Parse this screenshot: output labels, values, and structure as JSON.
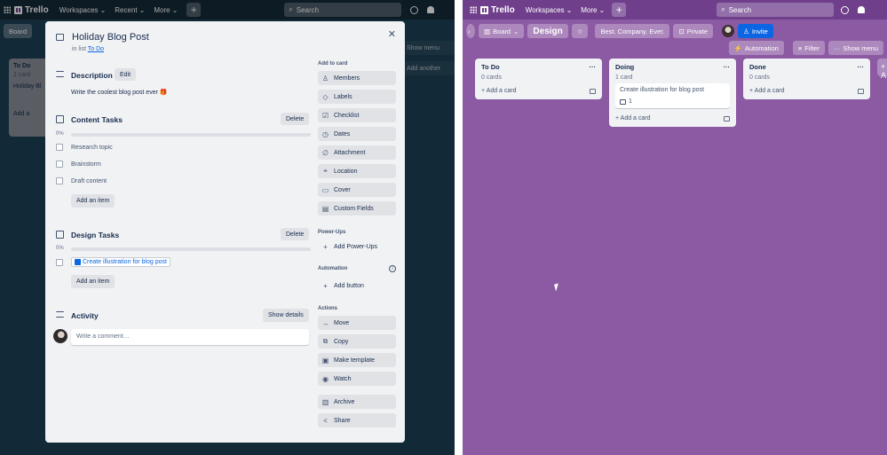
{
  "left_window": {
    "brand": "Trello",
    "nav": {
      "workspaces": "Workspaces",
      "recent": "Recent",
      "more": "More"
    },
    "search_placeholder": "Search",
    "board_view": "Board",
    "bg_list": {
      "title": "To Do",
      "sub": "1 card",
      "card": "Holiday Bl",
      "add": "Add a"
    },
    "bg_right": {
      "show_menu": "Show menu",
      "add_another": "Add another"
    }
  },
  "modal": {
    "title": "Holiday Blog Post",
    "in_list_prefix": "in list",
    "in_list_link": "To Do",
    "description": {
      "title": "Description",
      "edit": "Edit",
      "text": "Write the coolest blog post ever 🎁"
    },
    "content_tasks": {
      "title": "Content Tasks",
      "delete": "Delete",
      "percent": "0%",
      "progress": 0,
      "items": [
        "Research topic",
        "Brainstorm",
        "Draft content"
      ],
      "add_item": "Add an item"
    },
    "design_tasks": {
      "title": "Design Tasks",
      "delete": "Delete",
      "percent": "0%",
      "progress": 0,
      "item_link": "Create illustration for blog post",
      "add_item": "Add an item"
    },
    "activity": {
      "title": "Activity",
      "show_details": "Show details",
      "comment_placeholder": "Write a comment…"
    },
    "sidebar": {
      "add_to_card_label": "Add to card",
      "add_to_card": [
        {
          "label": "Members",
          "icon": "person-icon"
        },
        {
          "label": "Labels",
          "icon": "tag-icon"
        },
        {
          "label": "Checklist",
          "icon": "checklist-icon"
        },
        {
          "label": "Dates",
          "icon": "clock-icon"
        },
        {
          "label": "Attachment",
          "icon": "paperclip-icon"
        },
        {
          "label": "Location",
          "icon": "pin-icon"
        },
        {
          "label": "Cover",
          "icon": "cover-icon"
        },
        {
          "label": "Custom Fields",
          "icon": "fields-icon"
        }
      ],
      "powerups_label": "Power-Ups",
      "add_powerups": "Add Power-Ups",
      "automation_label": "Automation",
      "add_button": "Add button",
      "actions_label": "Actions",
      "actions": [
        {
          "label": "Move",
          "icon": "arrow-right-icon"
        },
        {
          "label": "Copy",
          "icon": "copy-icon"
        },
        {
          "label": "Make template",
          "icon": "template-icon"
        },
        {
          "label": "Watch",
          "icon": "eye-icon"
        }
      ],
      "actions2": [
        {
          "label": "Archive",
          "icon": "archive-icon"
        },
        {
          "label": "Share",
          "icon": "share-icon"
        }
      ]
    }
  },
  "right_window": {
    "brand": "Trello",
    "nav": {
      "workspaces": "Workspaces",
      "more": "More"
    },
    "search_placeholder": "Search",
    "board": {
      "view": "Board",
      "title": "Design",
      "workspace": "Best. Company. Ever.",
      "visibility": "Private",
      "invite": "Invite",
      "automation": "Automation",
      "filter": "Filter",
      "show_menu": "Show menu"
    },
    "lists": [
      {
        "title": "To Do",
        "count": "0 cards",
        "cards": [],
        "add": "Add a card"
      },
      {
        "title": "Doing",
        "count": "1 card",
        "cards": [
          {
            "title": "Create illustration for blog post",
            "checklist_badge": "1"
          }
        ],
        "add": "Add a card"
      },
      {
        "title": "Done",
        "count": "0 cards",
        "cards": [],
        "add": "Add a card"
      }
    ],
    "add_list": "+ A"
  },
  "colors": {
    "left_bg": "#1d3f55",
    "right_bg": "#8c5aa3",
    "accent": "#0c66e4"
  }
}
